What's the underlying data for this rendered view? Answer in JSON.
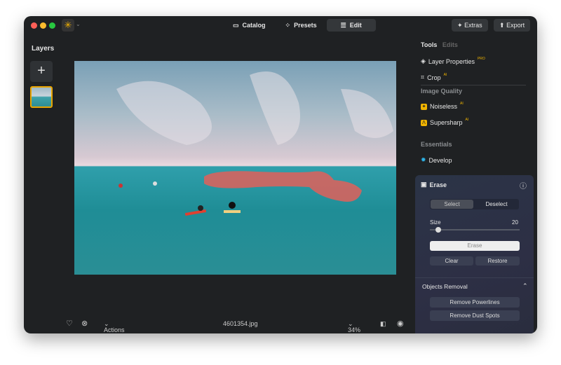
{
  "toolbar": {
    "nav": [
      {
        "label": "Catalog",
        "icon": "folder-icon"
      },
      {
        "label": "Presets",
        "icon": "wand-icon"
      },
      {
        "label": "Edit",
        "icon": "sliders-icon"
      }
    ],
    "active_nav": "Edit",
    "extras": "Extras",
    "export": "Export"
  },
  "layers": {
    "title": "Layers"
  },
  "bottom": {
    "actions": "Actions",
    "filename": "4601354.jpg",
    "zoom": "34%"
  },
  "tools": {
    "tab_tools": "Tools",
    "tab_edits": "Edits",
    "layer_properties": "Layer Properties",
    "pro": "PRO",
    "crop": "Crop",
    "ai": "AI",
    "image_quality": "Image Quality",
    "noiseless": "Noiseless",
    "supersharp": "Supersharp",
    "essentials": "Essentials",
    "develop": "Develop"
  },
  "erase": {
    "title": "Erase",
    "select": "Select",
    "deselect": "Deselect",
    "size_label": "Size",
    "size_value": "20",
    "size_fraction": 0.05,
    "erase_button": "Erase",
    "clear": "Clear",
    "restore": "Restore",
    "objects_removal": "Objects Removal",
    "remove_powerlines": "Remove Powerlines",
    "remove_dust": "Remove Dust Spots"
  },
  "colors": {
    "accent": "#f0b400",
    "mask": "#e0605a"
  }
}
